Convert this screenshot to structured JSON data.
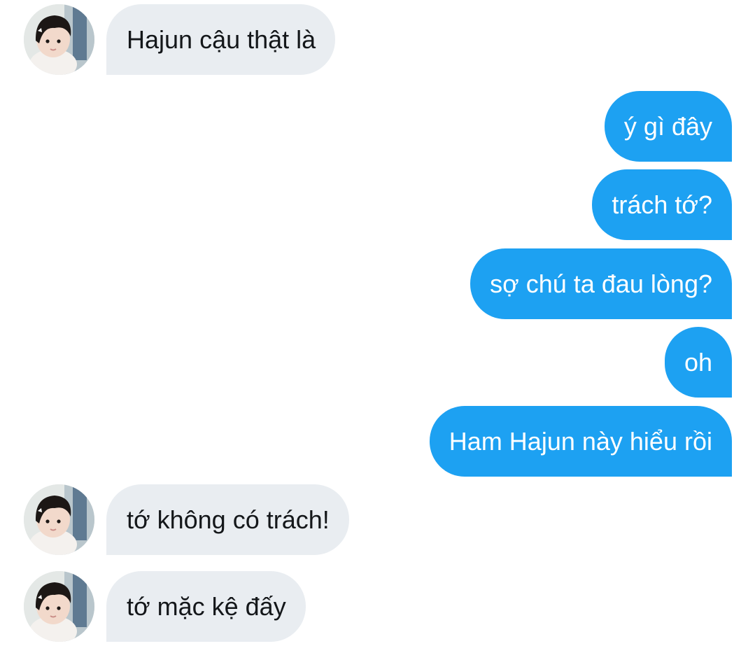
{
  "conversation": {
    "messages": [
      {
        "sender": "other",
        "text": "Hajun cậu thật là",
        "avatar": "child-photo-avatar"
      },
      {
        "sender": "me",
        "text": "ý gì đây"
      },
      {
        "sender": "me",
        "text": "trách tớ?"
      },
      {
        "sender": "me",
        "text": "sợ chú ta đau lòng?"
      },
      {
        "sender": "me",
        "text": "oh"
      },
      {
        "sender": "me",
        "text": "Ham Hajun này hiểu rồi"
      },
      {
        "sender": "other",
        "text": "tớ không có trách!",
        "avatar": "child-photo-avatar"
      },
      {
        "sender": "other",
        "text": "tớ mặc kệ đấy",
        "avatar": "child-photo-avatar"
      }
    ]
  },
  "colors": {
    "outgoing_bubble": "#1da1f2",
    "incoming_bubble": "#e9edf1",
    "outgoing_text": "#ffffff",
    "incoming_text": "#14171a"
  }
}
